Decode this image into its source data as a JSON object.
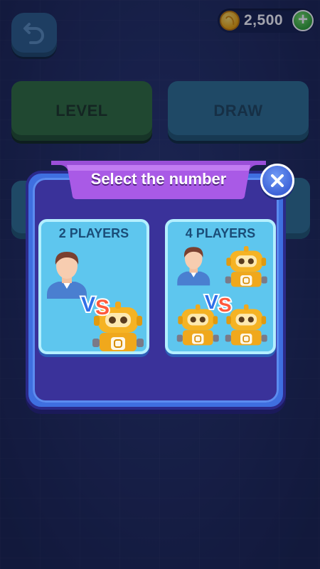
{
  "header": {
    "coins": "2,500"
  },
  "modes": {
    "level_label": "LEVEL",
    "draw_label": "DRAW"
  },
  "dialog": {
    "title": "Select the number",
    "options": [
      {
        "label": "2 PLAYERS",
        "vs": "VS"
      },
      {
        "label": "4 PLAYERS",
        "vs": "VS"
      }
    ]
  },
  "icons": {
    "back": "back-arrow-icon",
    "coin": "coin-icon",
    "add": "plus-icon",
    "close": "close-icon",
    "human": "human-avatar-icon",
    "robot": "robot-icon"
  },
  "colors": {
    "background": "#1f2b5c",
    "level_button": "#2e6c38",
    "draw_button": "#2c6f8d",
    "dialog_frame": "#3f6fe0",
    "dialog_body": "#3a329a",
    "banner": "#9b4fd8",
    "card": "#5ec6ee",
    "robot": "#f5b324",
    "vs_blue": "#2f6fe8",
    "vs_red": "#ff5a3c"
  }
}
